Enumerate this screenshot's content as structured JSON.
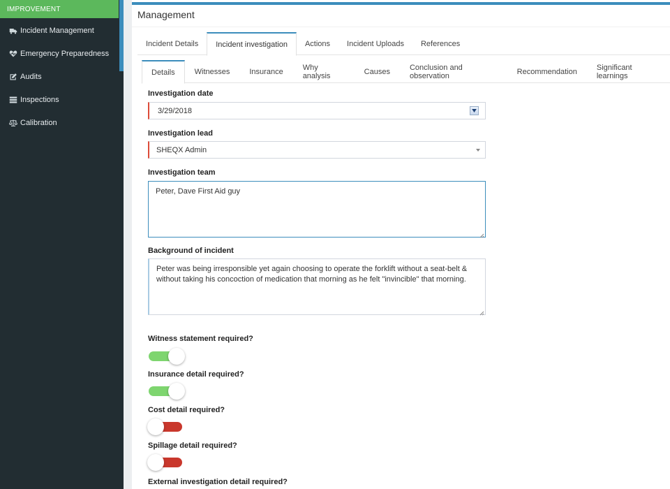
{
  "sidebar": {
    "section_header": "IMPROVEMENT",
    "items": [
      {
        "label": "Incident Management",
        "icon": "ambulance-icon"
      },
      {
        "label": "Emergency Preparedness",
        "icon": "heartbeat-icon"
      },
      {
        "label": "Audits",
        "icon": "edit-icon"
      },
      {
        "label": "Inspections",
        "icon": "server-icon"
      },
      {
        "label": "Calibration",
        "icon": "balance-scale-icon"
      }
    ]
  },
  "page": {
    "title": "Management"
  },
  "tabs_primary": [
    {
      "label": "Incident Details",
      "active": false
    },
    {
      "label": "Incident investigation",
      "active": true
    },
    {
      "label": "Actions",
      "active": false
    },
    {
      "label": "Incident Uploads",
      "active": false
    },
    {
      "label": "References",
      "active": false
    }
  ],
  "tabs_secondary": [
    {
      "label": "Details",
      "active": true
    },
    {
      "label": "Witnesses",
      "active": false
    },
    {
      "label": "Insurance",
      "active": false
    },
    {
      "label": "Why analysis",
      "active": false
    },
    {
      "label": "Causes",
      "active": false
    },
    {
      "label": "Conclusion and observation",
      "active": false
    },
    {
      "label": "Recommendation",
      "active": false
    },
    {
      "label": "Significant learnings",
      "active": false
    }
  ],
  "form": {
    "investigation_date": {
      "label": "Investigation date",
      "value": "3/29/2018"
    },
    "investigation_lead": {
      "label": "Investigation lead",
      "value": "SHEQX Admin"
    },
    "investigation_team": {
      "label": "Investigation team",
      "value": "Peter, Dave First Aid guy"
    },
    "background": {
      "label": "Background of incident",
      "value": "Peter was being irresponsible yet again choosing to operate the forklift without a seat-belt & without taking his concoction of medication that morning as he felt \"invincible\" that morning."
    },
    "toggles": [
      {
        "label": "Witness statement required?",
        "on": true
      },
      {
        "label": "Insurance detail required?",
        "on": true
      },
      {
        "label": "Cost detail required?",
        "on": false
      },
      {
        "label": "Spillage detail required?",
        "on": false
      }
    ],
    "external_label": "External investigation detail required?"
  },
  "colors": {
    "sidebar_bg": "#222d32",
    "sidebar_header": "#5cb85c",
    "accent": "#3c8dbc",
    "toggle_on": "#7ed56f",
    "toggle_off": "#c9372c",
    "required_marker": "#dd4b39"
  }
}
